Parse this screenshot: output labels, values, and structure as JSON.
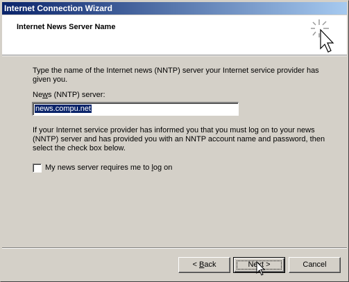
{
  "window": {
    "title": "Internet Connection Wizard"
  },
  "header": {
    "title": "Internet News Server Name",
    "icon": "wizard-sparkle-cursor-icon"
  },
  "body": {
    "intro": "Type the name of the Internet news (NNTP) server your Internet service provider has given you.",
    "field_label_pre": "Ne",
    "field_label_ul": "w",
    "field_label_post": "s (NNTP) server:",
    "field_value": "news.compu.net",
    "info": "If your Internet service provider has informed you that you must log on to your news (NNTP) server and has provided you with an NNTP account name and password, then select the check box below.",
    "checkbox_pre": "My news server requires me to ",
    "checkbox_ul": "l",
    "checkbox_post": "og on",
    "checkbox_checked": false
  },
  "buttons": {
    "back_pre": "< ",
    "back_ul": "B",
    "back_post": "ack",
    "next_pre": "Ne",
    "next_ul": "x",
    "next_post": "t >",
    "cancel": "Cancel"
  }
}
